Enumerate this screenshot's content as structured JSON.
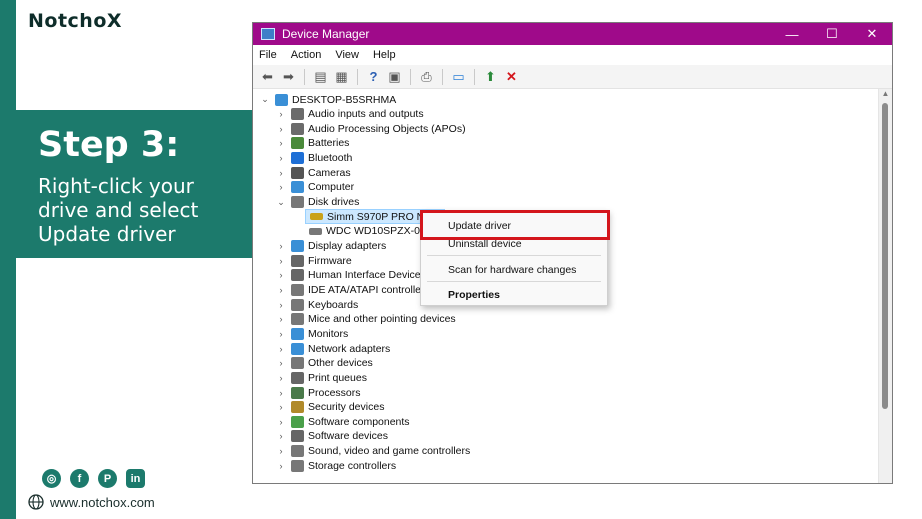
{
  "brand": {
    "logo_text": "NotchoX",
    "step_title": "Step 3:",
    "step_text": "Right-click your\ndrive and select\nUpdate driver",
    "website": "www.notchox.com",
    "social_icons": [
      "instagram-icon",
      "facebook-icon",
      "pinterest-icon",
      "linkedin-icon"
    ],
    "accent_color": "#1c7a6c"
  },
  "window": {
    "title": "Device Manager",
    "titlebar_color": "#9f0a8a",
    "controls": {
      "minimize": "—",
      "maximize": "☐",
      "close": "✕"
    },
    "menu": [
      "File",
      "Action",
      "View",
      "Help"
    ],
    "root_node": "DESKTOP-B5SRHMA",
    "categories": [
      {
        "label": "Audio inputs and outputs",
        "icon": "speaker-icon",
        "color": "#6b6b6b"
      },
      {
        "label": "Audio Processing Objects (APOs)",
        "icon": "speaker-icon",
        "color": "#6b6b6b"
      },
      {
        "label": "Batteries",
        "icon": "battery-icon",
        "color": "#4a8a3a"
      },
      {
        "label": "Bluetooth",
        "icon": "bluetooth-icon",
        "color": "#1e6fd6"
      },
      {
        "label": "Cameras",
        "icon": "camera-icon",
        "color": "#555555"
      },
      {
        "label": "Computer",
        "icon": "monitor-icon",
        "color": "#3a8fd6"
      },
      {
        "label": "Disk drives",
        "icon": "disk-icon",
        "color": "#777777"
      },
      {
        "label": "Display adapters",
        "icon": "display-adapter-icon",
        "color": "#3a8fd6"
      },
      {
        "label": "Firmware",
        "icon": "firmware-icon",
        "color": "#666666"
      },
      {
        "label": "Human Interface Devices",
        "icon": "hid-icon",
        "color": "#666666"
      },
      {
        "label": "IDE ATA/ATAPI controllers",
        "icon": "ide-icon",
        "color": "#777777"
      },
      {
        "label": "Keyboards",
        "icon": "keyboard-icon",
        "color": "#777777"
      },
      {
        "label": "Mice and other pointing devices",
        "icon": "mouse-icon",
        "color": "#777777"
      },
      {
        "label": "Monitors",
        "icon": "monitor-icon",
        "color": "#3a8fd6"
      },
      {
        "label": "Network adapters",
        "icon": "network-icon",
        "color": "#3a8fd6"
      },
      {
        "label": "Other devices",
        "icon": "unknown-device-icon",
        "color": "#777777"
      },
      {
        "label": "Print queues",
        "icon": "printer-icon",
        "color": "#666666"
      },
      {
        "label": "Processors",
        "icon": "processor-icon",
        "color": "#4a7a4a"
      },
      {
        "label": "Security devices",
        "icon": "security-icon",
        "color": "#b08a2a"
      },
      {
        "label": "Software components",
        "icon": "software-icon",
        "color": "#4aa04a"
      },
      {
        "label": "Software devices",
        "icon": "software-icon",
        "color": "#666666"
      },
      {
        "label": "Sound, video and game controllers",
        "icon": "sound-icon",
        "color": "#777777"
      },
      {
        "label": "Storage controllers",
        "icon": "storage-icon",
        "color": "#777777"
      }
    ],
    "disk_children": [
      "Simm S970P PRO NVM",
      "WDC WD10SPZX-08Z1"
    ]
  },
  "context_menu": {
    "update_driver": "Update driver",
    "uninstall_device": "Uninstall device",
    "scan_hardware": "Scan for hardware changes",
    "properties": "Properties",
    "highlight_color": "#d4161c"
  }
}
